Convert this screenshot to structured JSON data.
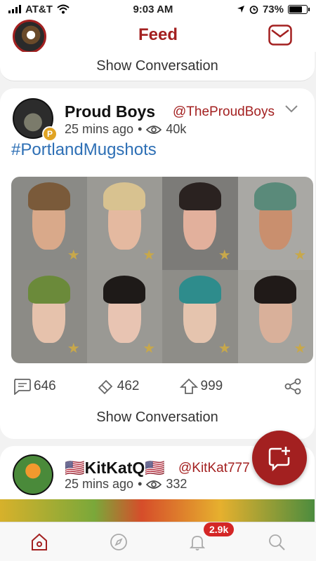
{
  "status": {
    "carrier": "AT&T",
    "time": "9:03 AM",
    "battery": "73%"
  },
  "header": {
    "title": "Feed"
  },
  "prev_post": {
    "show_conversation": "Show Conversation"
  },
  "post": {
    "name": "Proud Boys",
    "handle": "@TheProudBoys",
    "time": "25 mins ago",
    "dot": "•",
    "views": "40k",
    "text": "#PortlandMugshots",
    "comments": "646",
    "likes": "462",
    "reposts": "999",
    "show_conversation": "Show Conversation",
    "badge": "P"
  },
  "next_post": {
    "name": "🇺🇸KitKatQ🇺🇸",
    "handle": "@KitKat777",
    "time": "25 mins ago",
    "dot": "•",
    "views": "332"
  },
  "tabbar": {
    "notifications_count": "2.9k"
  },
  "colors": {
    "accent": "#a32020",
    "link": "#2d6fb5"
  }
}
